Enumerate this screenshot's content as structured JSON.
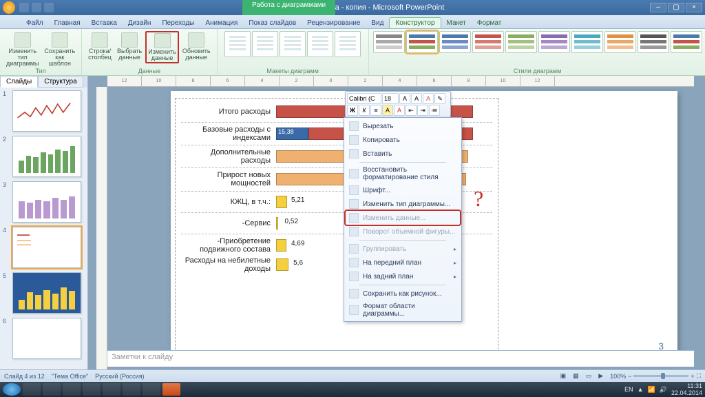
{
  "title": {
    "doc": "ФХД Метрополитена - копия",
    "app": "Microsoft PowerPoint",
    "ctx": "Работа с диаграммами"
  },
  "tabs": {
    "file": "Файл",
    "home": "Главная",
    "insert": "Вставка",
    "design": "Дизайн",
    "trans": "Переходы",
    "anim": "Анимация",
    "show": "Показ слайдов",
    "review": "Рецензирование",
    "view": "Вид",
    "ctor": "Конструктор",
    "layout": "Макет",
    "format": "Формат"
  },
  "ribbon": {
    "type_grp": "Тип",
    "type_change": "Изменить тип диаграммы",
    "type_save": "Сохранить как шаблон",
    "data_grp": "Данные",
    "data_switch": "Строка/столбец",
    "data_select": "Выбрать данные",
    "data_edit": "Изменить данные",
    "data_refresh": "Обновить данные",
    "layout_grp": "Макеты диаграмм",
    "style_grp": "Стили диаграмм"
  },
  "slidepanel": {
    "tab_slides": "Слайды",
    "tab_outline": "Структура"
  },
  "slides": [
    {
      "n": "1"
    },
    {
      "n": "2"
    },
    {
      "n": "3"
    },
    {
      "n": "4"
    },
    {
      "n": "5"
    },
    {
      "n": "6"
    }
  ],
  "chart_data": {
    "type": "bar",
    "orientation": "horizontal",
    "series": [
      {
        "name": "Итого расходы",
        "values": [
          90.98
        ],
        "color": "#c75248"
      },
      {
        "name": "Базовые расходы с индексами",
        "stack": [
          {
            "v": 15.38,
            "color": "#3a6aa8"
          },
          {
            "v": 75.6,
            "color": "#c75248"
          }
        ]
      },
      {
        "name": "Дополнительные расходы",
        "values": [
          89.32
        ],
        "color": "#f0b070"
      },
      {
        "name": "Прирост новых мощностей",
        "values": [
          88.1
        ],
        "color": "#f0b070"
      },
      {
        "name": "КЖЦ, в т.ч.:",
        "values": [
          5.21
        ],
        "color": "#f4d040"
      },
      {
        "name": "-Сервис",
        "values": [
          0.52
        ],
        "color": "#f4d040"
      },
      {
        "name": "-Приобретение подвижного состава",
        "values": [
          4.69
        ],
        "color": "#f4d040"
      },
      {
        "name": "Расходы на небилетные доходы",
        "values": [
          5.6
        ],
        "color": "#f4d040"
      }
    ],
    "labels": {
      "r0": "Итого расходы",
      "v0": "90,98",
      "r1": "Базовые расходы с индексами",
      "v1a": "15,38",
      "v1b": "75,6",
      "r2": "Дополнительные расходы",
      "v2": "89,32",
      "r3": "Прирост новых мощностей",
      "v3": "88,1",
      "r4": "КЖЦ, в т.ч.:",
      "v4": "5,21",
      "r5": "-Сервис",
      "v5": "0,52",
      "r6": "-Приобретение подвижного состава",
      "v6": "4,69",
      "r7": "Расходы на небилетные доходы",
      "v7": "5,6"
    },
    "xlim": [
      0,
      100
    ]
  },
  "slidenum": "3",
  "annotation": "?",
  "minitb": {
    "font": "Calibri (С",
    "size": "18"
  },
  "ctx": {
    "cut": "Вырезать",
    "copy": "Копировать",
    "paste": "Вставить",
    "reset": "Восстановить форматирование стиля",
    "font": "Шрифт...",
    "chtype": "Изменить тип диаграммы...",
    "chdata": "Изменить данные...",
    "rot3d": "Поворот объемной фигуры...",
    "group": "Группировать",
    "front": "На передний план",
    "back": "На задний план",
    "savepic": "Сохранить как рисунок...",
    "fmt": "Формат области диаграммы..."
  },
  "notes": "Заметки к слайду",
  "status": {
    "slide": "Слайд 4 из 12",
    "theme": "\"Тема Office\"",
    "lang": "Русский (Россия)",
    "zoom": "100%"
  },
  "tray": {
    "kb": "EN",
    "time": "11:31",
    "date": "22.04.2014"
  }
}
